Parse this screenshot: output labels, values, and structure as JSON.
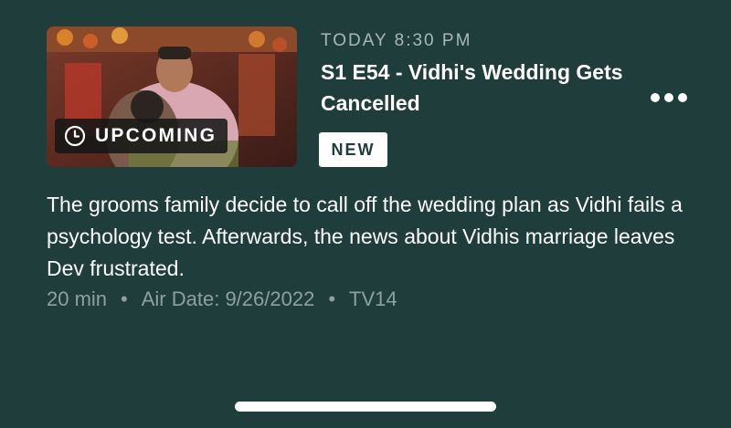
{
  "episode": {
    "thumbnail_icon": "episode-thumbnail-image",
    "status_label": "UPCOMING",
    "status_icon": "clock-icon",
    "air_time": "TODAY 8:30 PM",
    "title": "S1 E54 - Vidhi's Wedding Gets Cancelled",
    "badge": "NEW",
    "more_icon": "more-options-icon",
    "description": "The grooms family decide to call off the wedding plan as Vidhi fails a psychology test. Afterwards, the news about Vidhis marriage leaves Dev frustrated.",
    "meta": {
      "duration": "20 min",
      "separator": "•",
      "air_date": "Air Date: 9/26/2022",
      "rating": "TV14"
    }
  },
  "colors": {
    "background": "#1f3d3a",
    "text_primary": "#ffffff",
    "text_secondary": "#a9b8b5",
    "text_muted": "#8fa19e"
  }
}
